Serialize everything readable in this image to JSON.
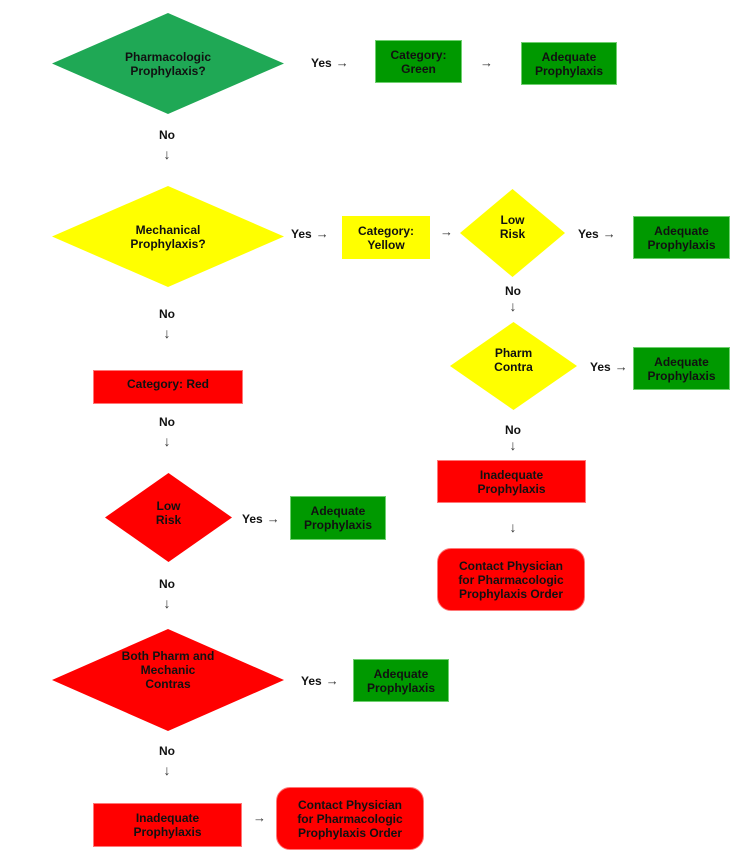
{
  "colors": {
    "green_diamond": "#1fa855",
    "green_box": "#009900",
    "yellow": "#ffff00",
    "red": "#ff0000"
  },
  "arrows": {
    "right": "→",
    "down": "↓"
  },
  "labels": {
    "yes": "Yes",
    "no": "No"
  },
  "nodes": {
    "pharm_prophylaxis_q": "Pharmacologic\nProphylaxis?",
    "category_green": "Category:\nGreen",
    "adequate_1": "Adequate\nProphylaxis",
    "mech_prophylaxis_q": "Mechanical\nProphylaxis?",
    "category_yellow": "Category:\nYellow",
    "yellow_low_risk_q": "Low\nRisk",
    "adequate_2": "Adequate\nProphylaxis",
    "pharm_contra_q": "Pharm\nContra",
    "adequate_3": "Adequate\nProphylaxis",
    "inadequate_yellow": "Inadequate\nProphylaxis",
    "contact_physician_yellow": "Contact Physician\nfor Pharmacologic\nProphylaxis Order",
    "category_red": "Category: Red",
    "red_low_risk_q": "Low\nRisk",
    "adequate_4": "Adequate\nProphylaxis",
    "both_contras_q": "Both Pharm and\nMechanic\nContras",
    "adequate_5": "Adequate\nProphylaxis",
    "inadequate_red": "Inadequate\nProphylaxis",
    "contact_physician_red": "Contact Physician\nfor Pharmacologic\nProphylaxis Order"
  }
}
